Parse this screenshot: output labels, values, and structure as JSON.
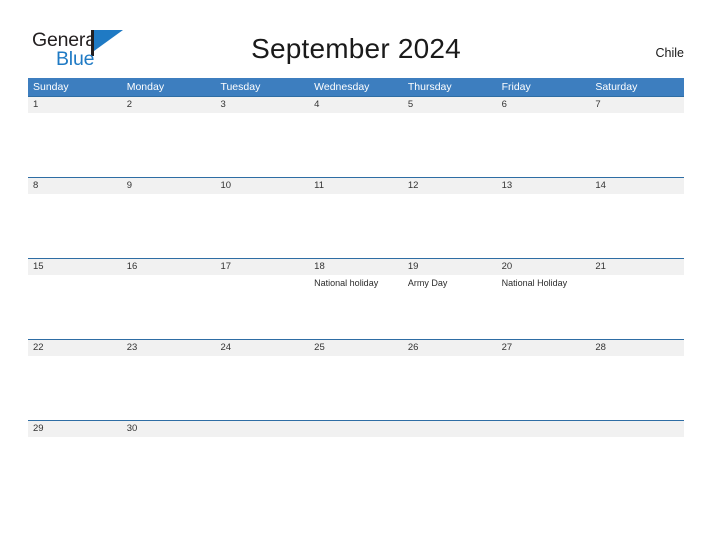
{
  "brand": {
    "name_line1": "General",
    "name_line2": "Blue",
    "triangle_icon": "triangle-logo-icon",
    "color_dark": "#231f20",
    "color_blue": "#1f7ac4"
  },
  "header": {
    "title": "September 2024",
    "region": "Chile"
  },
  "theme": {
    "header_blue": "#3d7ebf",
    "row_line_blue": "#2e6da4",
    "date_row_bg": "#f1f1f1",
    "text_dark": "#333333"
  },
  "calendar": {
    "day_headers": [
      "Sunday",
      "Monday",
      "Tuesday",
      "Wednesday",
      "Thursday",
      "Friday",
      "Saturday"
    ],
    "weeks": [
      {
        "dates": [
          "1",
          "2",
          "3",
          "4",
          "5",
          "6",
          "7"
        ],
        "events": [
          "",
          "",
          "",
          "",
          "",
          "",
          ""
        ]
      },
      {
        "dates": [
          "8",
          "9",
          "10",
          "11",
          "12",
          "13",
          "14"
        ],
        "events": [
          "",
          "",
          "",
          "",
          "",
          "",
          ""
        ]
      },
      {
        "dates": [
          "15",
          "16",
          "17",
          "18",
          "19",
          "20",
          "21"
        ],
        "events": [
          "",
          "",
          "",
          "National holiday",
          "Army Day",
          "National Holiday",
          ""
        ]
      },
      {
        "dates": [
          "22",
          "23",
          "24",
          "25",
          "26",
          "27",
          "28"
        ],
        "events": [
          "",
          "",
          "",
          "",
          "",
          "",
          ""
        ]
      },
      {
        "dates": [
          "29",
          "30",
          "",
          "",
          "",
          "",
          ""
        ],
        "events": [
          "",
          "",
          "",
          "",
          "",
          "",
          ""
        ]
      }
    ]
  }
}
